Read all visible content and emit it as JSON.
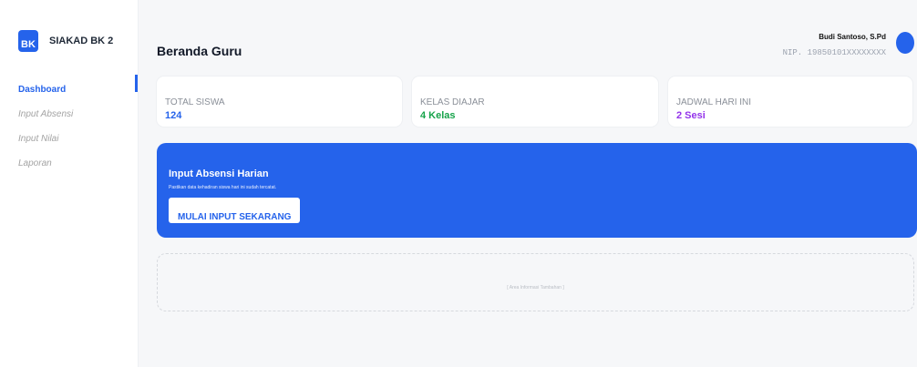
{
  "brand": {
    "logo_text": "BK",
    "name": "SIAKAD BK 2",
    "accent": "#2563eb"
  },
  "sidebar": {
    "items": [
      {
        "label": "Dashboard",
        "active": true
      },
      {
        "label": "Input Absensi",
        "active": false
      },
      {
        "label": "Input Nilai",
        "active": false
      },
      {
        "label": "Laporan",
        "active": false
      }
    ]
  },
  "header": {
    "title": "Beranda Guru",
    "user_name": "Budi Santoso, S.Pd",
    "user_nip": "NIP. 19850101XXXXXXXX"
  },
  "stats": [
    {
      "label": "TOTAL SISWA",
      "value": "124",
      "color": "#2563eb"
    },
    {
      "label": "KELAS DIAJAR",
      "value": "4 Kelas",
      "color": "#16a34a"
    },
    {
      "label": "JADWAL HARI INI",
      "value": "2 Sesi",
      "color": "#9333ea"
    }
  ],
  "banner": {
    "title": "Input Absensi Harian",
    "subtitle": "Pastikan data kehadiran siswa hari ini sudah tercatat.",
    "button_label": "MULAI INPUT SEKARANG"
  },
  "extra": {
    "placeholder": "[ Area Informasi Tambahan ]"
  }
}
